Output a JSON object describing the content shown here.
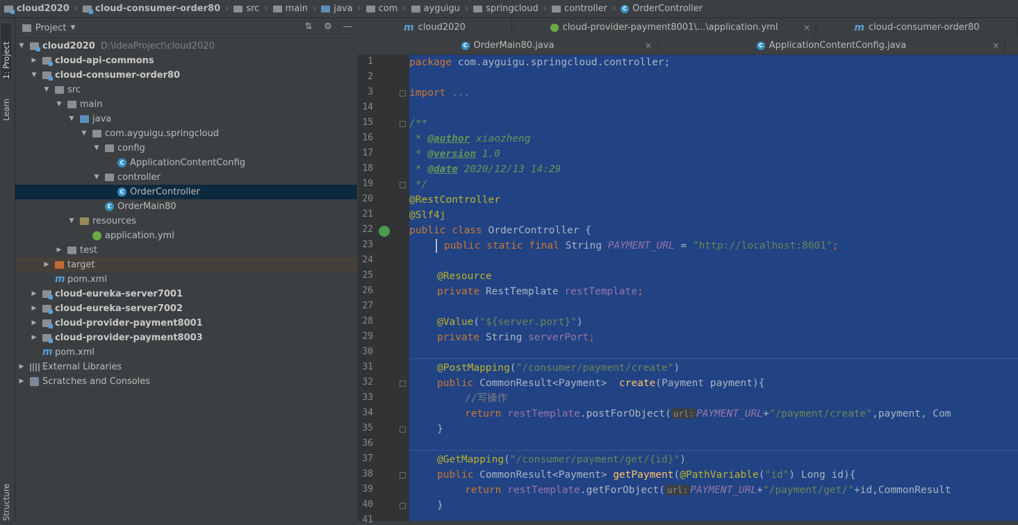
{
  "breadcrumb": [
    {
      "label": "cloud2020",
      "bold": true,
      "icon": "module-folder-icon"
    },
    {
      "label": "cloud-consumer-order80",
      "bold": true,
      "icon": "module-folder-icon"
    },
    {
      "label": "src",
      "icon": "folder-icon"
    },
    {
      "label": "main",
      "icon": "folder-icon"
    },
    {
      "label": "java",
      "icon": "source-folder-icon"
    },
    {
      "label": "com",
      "icon": "folder-icon"
    },
    {
      "label": "ayguigu",
      "icon": "folder-icon"
    },
    {
      "label": "springcloud",
      "icon": "folder-icon"
    },
    {
      "label": "controller",
      "icon": "folder-icon"
    },
    {
      "label": "OrderController",
      "icon": "class-icon"
    }
  ],
  "stripe": {
    "project_tab": "1: Project",
    "learn_tab": "Learn",
    "structure_tab": "Structure"
  },
  "panel": {
    "title": "Project",
    "settings_icon": "gear-icon",
    "collapse_icon": "collapse-all-icon",
    "hide_icon": "minimize-icon"
  },
  "tree": {
    "root_label": "cloud2020",
    "root_path": "D:\\IdeaProject\\cloud2020",
    "api_commons": "cloud-api-commons",
    "consumer": "cloud-consumer-order80",
    "src": "src",
    "main": "main",
    "java": "java",
    "pkg": "com.ayguigu.springcloud",
    "config": "config",
    "app_config": "ApplicationContentConfig",
    "controller": "controller",
    "order_controller": "OrderController",
    "order_main": "OrderMain80",
    "resources": "resources",
    "app_yml": "application.yml",
    "test": "test",
    "target": "target",
    "pom1": "pom.xml",
    "eureka7001": "cloud-eureka-server7001",
    "eureka7002": "cloud-eureka-server7002",
    "payment8001": "cloud-provider-payment8001",
    "payment8003": "cloud-provider-payment8003",
    "pom2": "pom.xml",
    "ext_libs": "External Libraries",
    "scratches": "Scratches and Consoles"
  },
  "editor_tabs_row1": [
    {
      "label": "cloud2020",
      "icon": "maven-icon"
    },
    {
      "label": "cloud-provider-payment8001\\...\\application.yml",
      "icon": "spring-icon"
    },
    {
      "label": "cloud-consumer-order80",
      "icon": "maven-icon"
    }
  ],
  "editor_tabs_row2": [
    {
      "label": "OrderMain80.java",
      "icon": "class-icon"
    },
    {
      "label": "ApplicationContentConfig.java",
      "icon": "class-icon"
    }
  ],
  "gutter": {
    "line_numbers": [
      "1",
      "2",
      "3",
      "14",
      "15",
      "16",
      "17",
      "18",
      "19",
      "20",
      "21",
      "22",
      "23",
      "24",
      "25",
      "26",
      "27",
      "28",
      "29",
      "30",
      "31",
      "32",
      "33",
      "34",
      "35",
      "36",
      "37",
      "38",
      "39",
      "40",
      "41"
    ]
  },
  "code": {
    "l1_kw": "package",
    "l1_rest": " com.ayguigu.springcloud.controller;",
    "l3_kw": "import",
    "l3_rest": " ...",
    "l15": "/**",
    "l16_pre": " * ",
    "l16_tag": "@author",
    "l16_val": " xiaozheng",
    "l17_pre": " * ",
    "l17_tag": "@version",
    "l17_val": " 1.0",
    "l18_pre": " * ",
    "l18_tag": "@date",
    "l18_val": " 2020/12/13 14:29",
    "l19": " */",
    "l20": "@RestController",
    "l21": "@Slf4j",
    "l22_kw": "public class",
    "l22_rest": " OrderController {",
    "l23_kw": "public static final",
    "l23_type": " String ",
    "l23_fld": "PAYMENT_URL",
    "l23_eq": " = ",
    "l23_str": "\"http://localhost:8001\"",
    "l23_end": ";",
    "l25": "@Resource",
    "l26_kw": "private",
    "l26_type": " RestTemplate ",
    "l26_fld": "restTemplate",
    "l26_end": ";",
    "l28_ann": "@Value",
    "l28_p1": "(",
    "l28_str": "\"${server.port}\"",
    "l28_p2": ")",
    "l29_kw": "private",
    "l29_type": " String ",
    "l29_fld": "serverPort",
    "l29_end": ";",
    "l31_ann": "@PostMapping",
    "l31_p1": "(",
    "l31_str": "\"/consumer/payment/create\"",
    "l31_p2": ")",
    "l32_kw": "public",
    "l32_type": " CommonResult<Payment>  ",
    "l32_m": "create",
    "l32_rest": "(Payment payment){",
    "l33": "//写操作",
    "l34_kw": "return",
    "l34_sp": " ",
    "l34_fld": "restTemplate",
    "l34_call": ".postForObject(",
    "l34_hint": "url:",
    "l34_const": "PAYMENT_URL",
    "l34_plus": "+",
    "l34_str": "\"/payment/create\"",
    "l34_rest": ",payment, Com",
    "l35": "}",
    "l37_ann": "@GetMapping",
    "l37_p1": "(",
    "l37_str": "\"/consumer/payment/get/{id}\"",
    "l37_p2": ")",
    "l38_kw": "public",
    "l38_type": " CommonResult<Payment> ",
    "l38_m": "getPayment",
    "l38_p": "(",
    "l38_ann": "@PathVariable",
    "l38_p2": "(",
    "l38_str": "\"id\"",
    "l38_rest": ") Long id){",
    "l39_kw": "return",
    "l39_sp": " ",
    "l39_fld": "restTemplate",
    "l39_call": ".getForObject(",
    "l39_hint": "url:",
    "l39_const": "PAYMENT_URL",
    "l39_plus": "+",
    "l39_str": "\"/payment/get/\"",
    "l39_rest": "+id,CommonResult",
    "l40": "}"
  },
  "colors": {
    "keyword": "#cc7832",
    "annotation": "#bbb529",
    "string": "#6a8759",
    "field": "#9876aa",
    "comment": "#629755",
    "selection": "#214283"
  }
}
